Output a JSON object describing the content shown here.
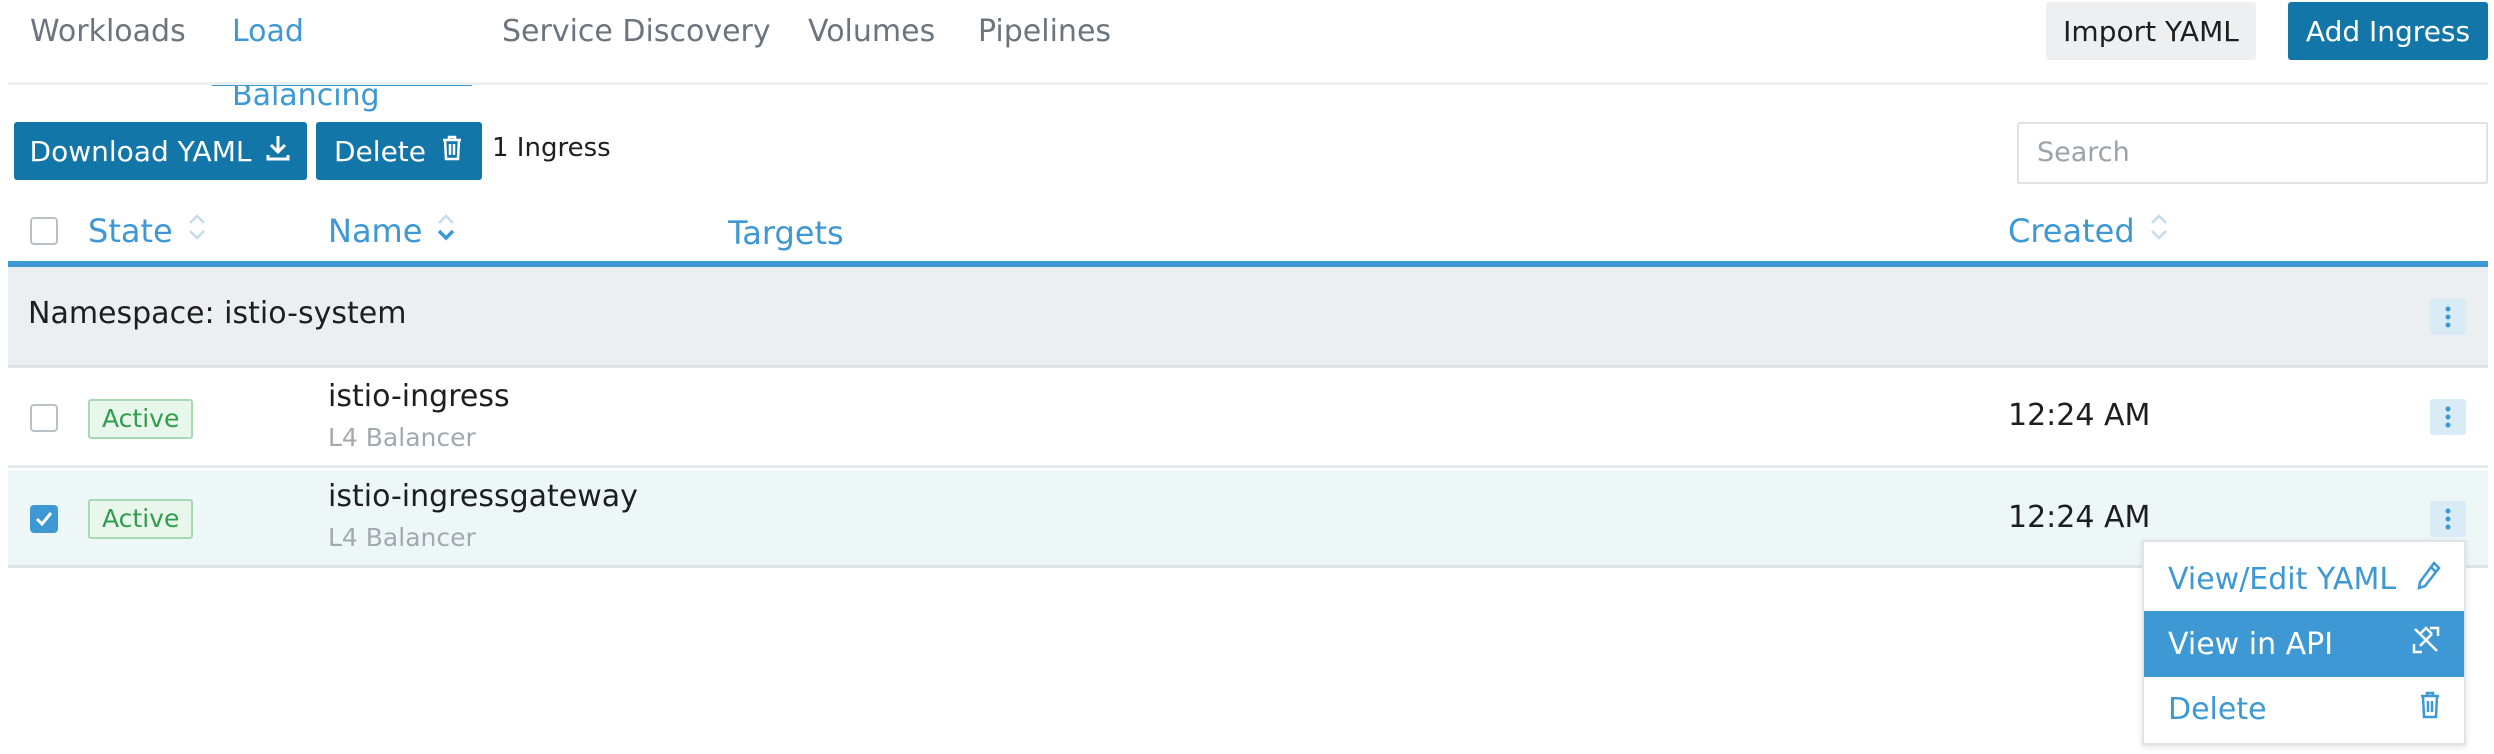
{
  "tabs": [
    {
      "label": "Workloads",
      "active": false
    },
    {
      "label": "Load Balancing",
      "active": true
    },
    {
      "label": "Service Discovery",
      "active": false
    },
    {
      "label": "Volumes",
      "active": false
    },
    {
      "label": "Pipelines",
      "active": false
    }
  ],
  "actions": {
    "import_yaml": "Import YAML",
    "add_ingress": "Add Ingress"
  },
  "toolbar": {
    "download_yaml": "Download YAML",
    "delete": "Delete",
    "count": "1 Ingress"
  },
  "search": {
    "placeholder": "Search"
  },
  "table": {
    "headers": {
      "state": "State",
      "name": "Name",
      "targets": "Targets",
      "created": "Created"
    },
    "group": {
      "label": "Namespace: istio-system"
    },
    "rows": [
      {
        "state": "Active",
        "name": "istio-ingress",
        "type": "L4 Balancer",
        "created": "12:24 AM",
        "selected": false
      },
      {
        "state": "Active",
        "name": "istio-ingressgateway",
        "type": "L4 Balancer",
        "created": "12:24 AM",
        "selected": true
      }
    ]
  },
  "context_menu": {
    "items": [
      {
        "label": "View/Edit YAML",
        "icon": "pencil-icon"
      },
      {
        "label": "View in API",
        "icon": "external-link-icon",
        "highlighted": true
      },
      {
        "label": "Delete",
        "icon": "trash-icon"
      }
    ]
  },
  "colors": {
    "accent": "#3d98d3",
    "primary_button": "#1376a9",
    "active_badge": "#2f9e4d"
  }
}
